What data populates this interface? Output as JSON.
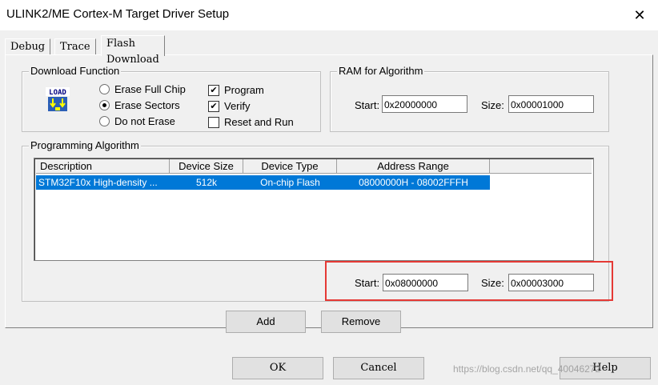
{
  "window": {
    "title": "ULINK2/ME Cortex-M Target Driver Setup",
    "close_glyph": "✕"
  },
  "tabs": [
    {
      "label": "Debug"
    },
    {
      "label": "Trace"
    },
    {
      "label": "Flash Download",
      "active": true
    }
  ],
  "download_function": {
    "title": "Download Function",
    "icon_text": "LOAD",
    "radios": [
      {
        "label": "Erase Full Chip",
        "selected": false
      },
      {
        "label": "Erase Sectors",
        "selected": true
      },
      {
        "label": "Do not Erase",
        "selected": false
      }
    ],
    "checks": [
      {
        "label": "Program",
        "checked": true
      },
      {
        "label": "Verify",
        "checked": true
      },
      {
        "label": "Reset and Run",
        "checked": false
      }
    ]
  },
  "ram": {
    "title": "RAM for Algorithm",
    "start_label": "Start:",
    "start_value": "0x20000000",
    "size_label": "Size:",
    "size_value": "0x00001000"
  },
  "algorithm": {
    "title": "Programming Algorithm",
    "columns": [
      "Description",
      "Device Size",
      "Device Type",
      "Address Range"
    ],
    "rows": [
      {
        "description": "STM32F10x High-density ...",
        "size": "512k",
        "type": "On-chip Flash",
        "range": "08000000H - 08002FFFH"
      }
    ],
    "start_label": "Start:",
    "start_value": "0x08000000",
    "size_label": "Size:",
    "size_value": "0x00003000"
  },
  "buttons": {
    "add": "Add",
    "remove": "Remove",
    "ok": "OK",
    "cancel": "Cancel",
    "help": "Help"
  },
  "watermark": "https://blog.csdn.net/qq_40046272",
  "colors": {
    "selection": "#0078d7",
    "highlight_box": "#e53935"
  }
}
